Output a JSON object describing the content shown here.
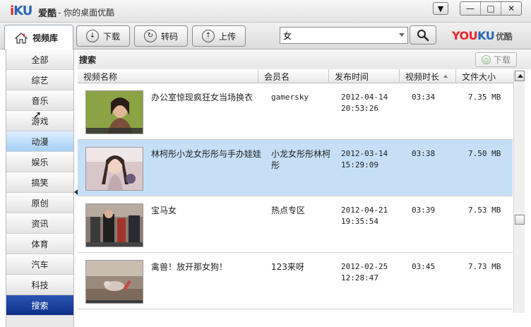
{
  "window": {
    "logo_i": "i",
    "logo_ku": "KU",
    "app_name": "爱酷",
    "subtitle": "- 你的桌面优酷",
    "menu_glyph": "▼",
    "min_glyph": "—",
    "max_glyph": "□",
    "close_glyph": "✕"
  },
  "toolbar": {
    "library_label": "视频库",
    "download_label": "下载",
    "transcode_label": "转码",
    "upload_label": "上传",
    "search_value": "女",
    "brand_you": "YOU",
    "brand_ku": "KU",
    "brand_cn": "优酷"
  },
  "sidebar": {
    "items": [
      {
        "label": "全部"
      },
      {
        "label": "综艺"
      },
      {
        "label": "音乐"
      },
      {
        "label": "游戏"
      },
      {
        "label": "动漫"
      },
      {
        "label": "娱乐"
      },
      {
        "label": "搞笑"
      },
      {
        "label": "原创"
      },
      {
        "label": "资讯"
      },
      {
        "label": "体育"
      },
      {
        "label": "汽车"
      },
      {
        "label": "科技"
      },
      {
        "label": "搜索"
      }
    ]
  },
  "content": {
    "title": "搜索",
    "download_button": "下载",
    "columns": [
      "视频名称",
      "会员名",
      "发布时间",
      "视频时长",
      "文件大小"
    ],
    "rows": [
      {
        "title": "办公室惊现疯狂女当场换衣",
        "user": "gamersky",
        "date": "2012-04-14",
        "time": "20:53:26",
        "duration": "03:34",
        "size": "7.35 MB"
      },
      {
        "title": "林柯彤小龙女彤彤与手办娃娃",
        "user": "小龙女彤彤林柯彤",
        "date": "2012-03-14",
        "time": "15:29:09",
        "duration": "03:38",
        "size": "7.50 MB"
      },
      {
        "title": "宝马女",
        "user": "热点专区",
        "date": "2012-04-21",
        "time": "19:35:54",
        "duration": "03:39",
        "size": "7.53 MB"
      },
      {
        "title": "禽兽！放开那女狗！",
        "user": "123来呀",
        "date": "2012-02-25",
        "time": "12:28:47",
        "duration": "03:45",
        "size": "7.73 MB"
      }
    ]
  },
  "colors": {
    "accent_active": "#0c2f86",
    "selection": "#c6dff7",
    "brand_red": "#e8262a",
    "brand_blue": "#2a65b5"
  }
}
